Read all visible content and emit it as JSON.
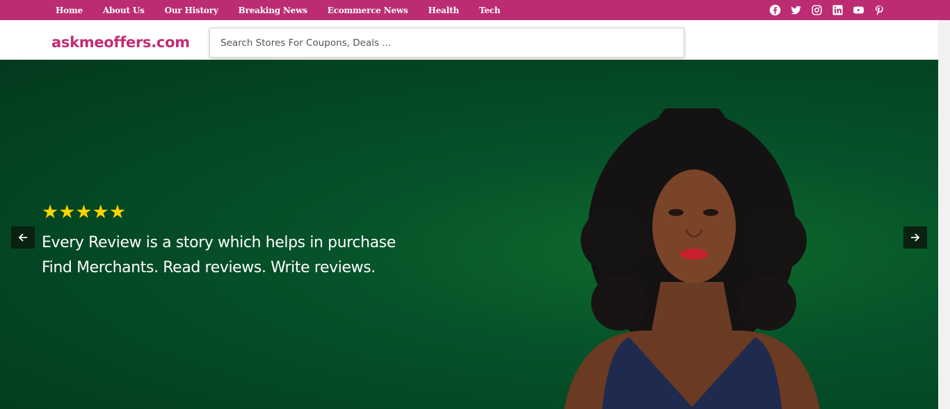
{
  "nav": {
    "items": [
      {
        "label": "Home"
      },
      {
        "label": "About Us"
      },
      {
        "label": "Our History"
      },
      {
        "label": "Breaking News"
      },
      {
        "label": "Ecommerce News"
      },
      {
        "label": "Health"
      },
      {
        "label": "Tech"
      }
    ]
  },
  "social": [
    "facebook-icon",
    "twitter-icon",
    "instagram-icon",
    "linkedin-icon",
    "youtube-icon",
    "pinterest-icon"
  ],
  "header": {
    "logo": "askmeoffers.com",
    "search_placeholder": "Search Stores For Coupons, Deals ..."
  },
  "hero": {
    "rating": "★★★★★",
    "line1": "Every Review is a story which helps in purchase",
    "line2": "Find Merchants. Read reviews. Write reviews."
  },
  "colors": {
    "brand": "#bb2c72",
    "logo": "#c12d75",
    "hero_bg": "#06532a",
    "stars": "#ffd400"
  }
}
